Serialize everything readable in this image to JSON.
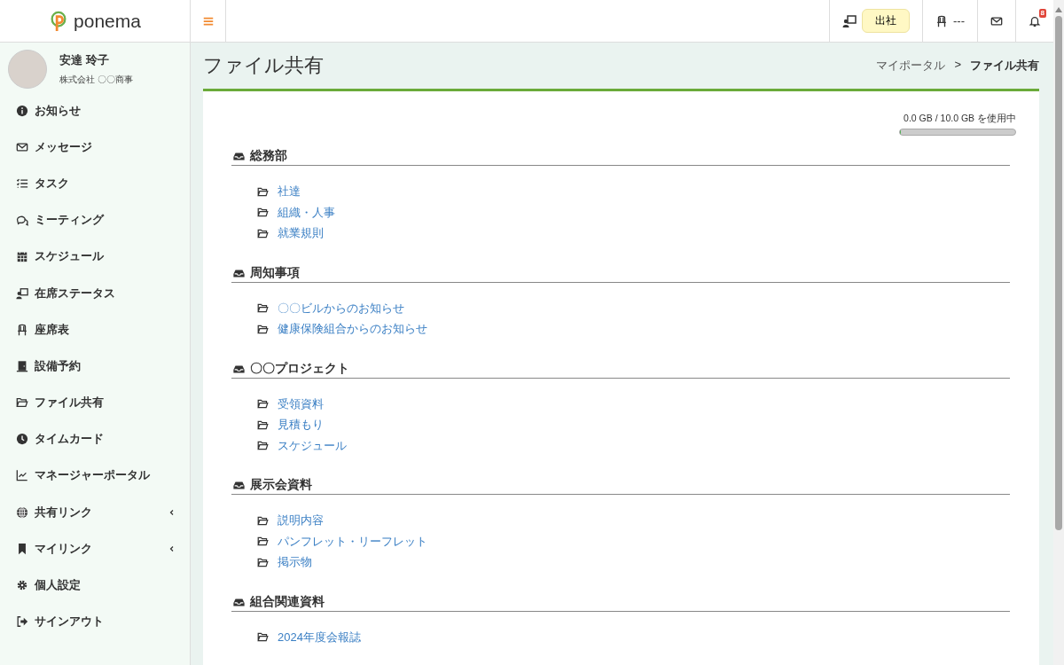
{
  "header": {
    "logo": "ponema",
    "attendance": "出社",
    "seat": "---",
    "notifications_count": "8"
  },
  "user": {
    "name": "安達 玲子",
    "company": "株式会社 〇〇商事"
  },
  "sidebar": {
    "items": [
      {
        "label": "お知らせ",
        "has_submenu": false
      },
      {
        "label": "メッセージ",
        "has_submenu": false
      },
      {
        "label": "タスク",
        "has_submenu": false
      },
      {
        "label": "ミーティング",
        "has_submenu": false
      },
      {
        "label": "スケジュール",
        "has_submenu": false
      },
      {
        "label": "在席ステータス",
        "has_submenu": false
      },
      {
        "label": "座席表",
        "has_submenu": false
      },
      {
        "label": "設備予約",
        "has_submenu": false
      },
      {
        "label": "ファイル共有",
        "has_submenu": false
      },
      {
        "label": "タイムカード",
        "has_submenu": false
      },
      {
        "label": "マネージャーポータル",
        "has_submenu": false
      },
      {
        "label": "共有リンク",
        "has_submenu": true
      },
      {
        "label": "マイリンク",
        "has_submenu": true
      },
      {
        "label": "個人設定",
        "has_submenu": false
      },
      {
        "label": "サインアウト",
        "has_submenu": false
      }
    ]
  },
  "page": {
    "title": "ファイル共有",
    "breadcrumb": [
      "マイポータル",
      "ファイル共有"
    ],
    "breadcrumb_separator": ">"
  },
  "storage": {
    "text": "0.0 GB / 10.0 GB を使用中",
    "level": 0.01
  },
  "sections": [
    {
      "title": "総務部",
      "folders": [
        "社達",
        "組織・人事",
        "就業規則"
      ]
    },
    {
      "title": "周知事項",
      "folders": [
        "〇〇ビルからのお知らせ",
        "健康保険組合からのお知らせ"
      ]
    },
    {
      "title": "〇〇プロジェクト",
      "folders": [
        "受領資料",
        "見積もり",
        "スケジュール"
      ]
    },
    {
      "title": "展示会資料",
      "folders": [
        "説明内容",
        "パンフレット・リーフレット",
        "掲示物"
      ]
    },
    {
      "title": "組合関連資料",
      "folders": [
        "2024年度会報誌"
      ]
    }
  ]
}
